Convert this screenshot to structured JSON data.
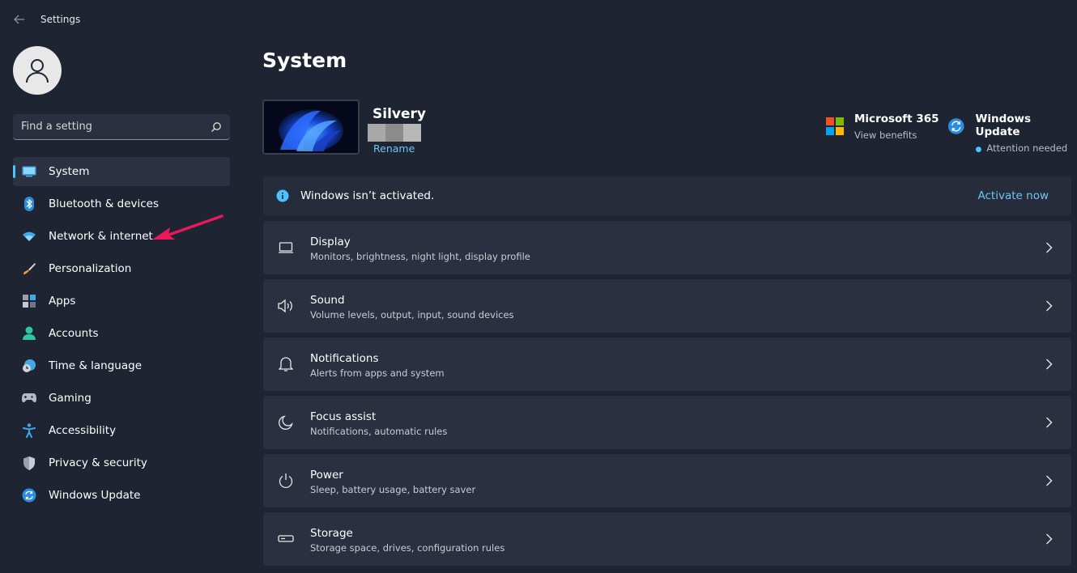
{
  "window": {
    "title": "Settings"
  },
  "sidebar": {
    "search_placeholder": "Find a setting",
    "items": [
      {
        "label": "System",
        "icon": "monitor-icon",
        "selected": true
      },
      {
        "label": "Bluetooth & devices",
        "icon": "bluetooth-icon"
      },
      {
        "label": "Network & internet",
        "icon": "wifi-icon"
      },
      {
        "label": "Personalization",
        "icon": "brush-icon"
      },
      {
        "label": "Apps",
        "icon": "apps-icon"
      },
      {
        "label": "Accounts",
        "icon": "person-icon"
      },
      {
        "label": "Time & language",
        "icon": "globe-clock-icon"
      },
      {
        "label": "Gaming",
        "icon": "gamepad-icon"
      },
      {
        "label": "Accessibility",
        "icon": "accessibility-icon"
      },
      {
        "label": "Privacy & security",
        "icon": "shield-icon"
      },
      {
        "label": "Windows Update",
        "icon": "update-icon"
      }
    ]
  },
  "main": {
    "title": "System",
    "device": {
      "name": "Silvery",
      "rename": "Rename"
    },
    "quick_links": [
      {
        "title": "Microsoft 365",
        "subtitle": "View benefits",
        "icon": "microsoft-logo-icon"
      },
      {
        "title": "Windows Update",
        "subtitle": "Attention needed",
        "icon": "update-icon"
      }
    ],
    "banner": {
      "text": "Windows isn’t activated.",
      "link": "Activate now",
      "icon": "info-icon"
    },
    "cards": [
      {
        "title": "Display",
        "subtitle": "Monitors, brightness, night light, display profile",
        "icon": "display-icon"
      },
      {
        "title": "Sound",
        "subtitle": "Volume levels, output, input, sound devices",
        "icon": "speaker-icon"
      },
      {
        "title": "Notifications",
        "subtitle": "Alerts from apps and system",
        "icon": "bell-icon"
      },
      {
        "title": "Focus assist",
        "subtitle": "Notifications, automatic rules",
        "icon": "moon-icon"
      },
      {
        "title": "Power",
        "subtitle": "Sleep, battery usage, battery saver",
        "icon": "power-icon"
      },
      {
        "title": "Storage",
        "subtitle": "Storage space, drives, configuration rules",
        "icon": "storage-icon"
      }
    ]
  },
  "colors": {
    "accent": "#4cc2ff",
    "link": "#6dc7f5",
    "annotation_arrow": "#e8195a"
  }
}
